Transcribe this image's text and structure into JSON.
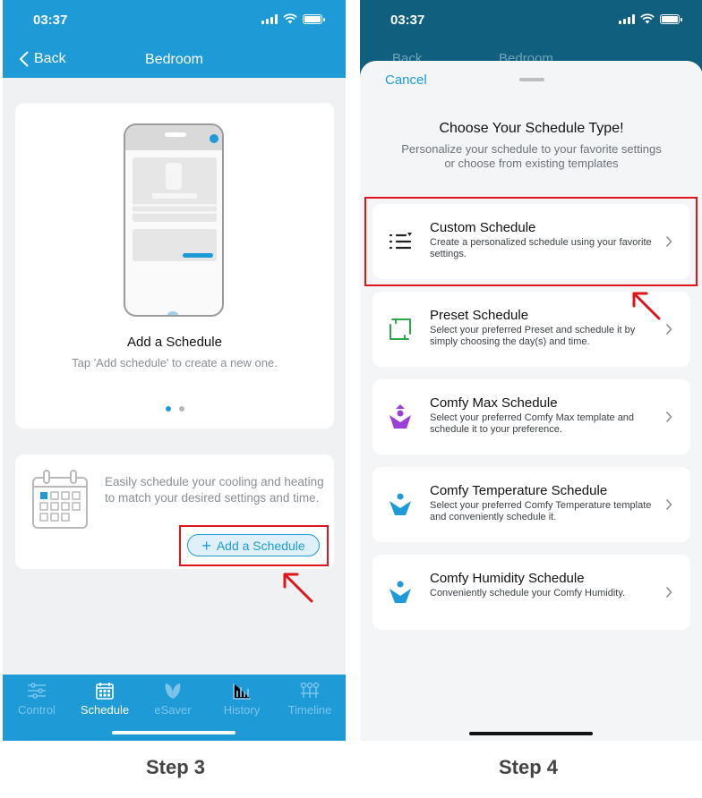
{
  "step3": {
    "label": "Step 3",
    "status": {
      "time": "03:37"
    },
    "nav": {
      "back_label": "Back",
      "title": "Bedroom"
    },
    "intro": {
      "title": "Add a Schedule",
      "subtitle": "Tap 'Add schedule' to create a new one.",
      "page_count": 2,
      "active_page": 1
    },
    "add_card": {
      "text": "Easily schedule your cooling and heating to match your desired settings and time.",
      "button_label": "Add a Schedule"
    },
    "tabs": [
      {
        "label": "Control",
        "icon": "sliders-icon",
        "active": false
      },
      {
        "label": "Schedule",
        "icon": "calendar-icon",
        "active": true
      },
      {
        "label": "eSaver",
        "icon": "leaf-icon",
        "active": false
      },
      {
        "label": "History",
        "icon": "bar-chart-icon",
        "active": false
      },
      {
        "label": "Timeline",
        "icon": "timeline-icon",
        "active": false
      }
    ]
  },
  "step4": {
    "label": "Step 4",
    "status": {
      "time": "03:37"
    },
    "behind_nav": {
      "back_label": "Back",
      "title": "Bedroom"
    },
    "sheet": {
      "cancel_label": "Cancel",
      "title": "Choose Your Schedule Type!",
      "subtitle": "Personalize your schedule to your favorite settings or choose from existing templates"
    },
    "options": [
      {
        "name": "Custom Schedule",
        "description": "Create a personalized schedule using your favorite settings.",
        "icon": "custom-list-icon"
      },
      {
        "name": "Preset Schedule",
        "description": "Select your preferred Preset and schedule it by simply choosing the day(s) and time.",
        "icon": "preset-frame-icon"
      },
      {
        "name": "Comfy Max Schedule",
        "description": "Select your preferred Comfy Max template and schedule it to your preference.",
        "icon": "comfy-max-icon"
      },
      {
        "name": "Comfy Temperature Schedule",
        "description": "Select your preferred Comfy Temperature template and conveniently schedule it.",
        "icon": "comfy-person-icon"
      },
      {
        "name": "Comfy Humidity Schedule",
        "description": "Conveniently schedule your Comfy Humidity.",
        "icon": "comfy-person-icon"
      }
    ]
  },
  "colors": {
    "brand_blue": "#1e9bd7",
    "highlight_red": "#e0141b",
    "header_dark": "#115f7e",
    "green": "#2aa84a",
    "purple": "#9b3fd6"
  }
}
